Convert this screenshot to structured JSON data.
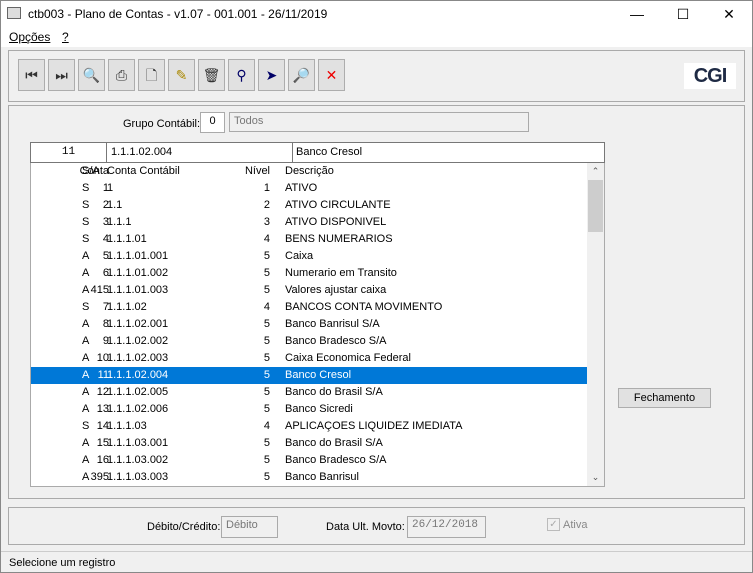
{
  "window": {
    "title": "ctb003 - Plano de Contas - v1.07 - 001.001 - 26/11/2019",
    "minimize": "—",
    "maximize": "☐",
    "close": "✕"
  },
  "menu": [
    "Opções",
    "?"
  ],
  "toolbar": [
    {
      "name": "first-record",
      "glyph": "⏮",
      "color": "#333"
    },
    {
      "name": "last-record",
      "glyph": "⏭",
      "color": "#333"
    },
    {
      "name": "search",
      "glyph": "🔍",
      "color": "#036"
    },
    {
      "name": "print",
      "glyph": "⎙",
      "color": "#333"
    },
    {
      "name": "new",
      "glyph": "🗋",
      "color": "#333"
    },
    {
      "name": "edit",
      "glyph": "✎",
      "color": "#a80"
    },
    {
      "name": "delete",
      "glyph": "🗑",
      "color": "#333"
    },
    {
      "name": "find",
      "glyph": "⚲",
      "color": "#006"
    },
    {
      "name": "filter",
      "glyph": "➤",
      "color": "#006"
    },
    {
      "name": "zoom",
      "glyph": "🔎",
      "color": "#36c"
    },
    {
      "name": "cancel",
      "glyph": "✕",
      "color": "#e00"
    }
  ],
  "logo": "CGI",
  "grupo": {
    "label": "Grupo Contábil:",
    "code": "0",
    "name": "Todos"
  },
  "selected": {
    "conta": "11",
    "conta_contabil": "1.1.1.02.004",
    "descricao": "Banco Cresol"
  },
  "columns": [
    "Conta",
    "S/A",
    "Conta Contábil",
    "Nível",
    "Descrição"
  ],
  "rows": [
    [
      "1",
      "S",
      "1",
      "1",
      "ATIVO"
    ],
    [
      "2",
      "S",
      "1.1",
      "2",
      "ATIVO CIRCULANTE"
    ],
    [
      "3",
      "S",
      "1.1.1",
      "3",
      "ATIVO DISPONIVEL"
    ],
    [
      "4",
      "S",
      "1.1.1.01",
      "4",
      "BENS NUMERARIOS"
    ],
    [
      "5",
      "A",
      "1.1.1.01.001",
      "5",
      "Caixa"
    ],
    [
      "6",
      "A",
      "1.1.1.01.002",
      "5",
      "Numerario em Transito"
    ],
    [
      "415",
      "A",
      "1.1.1.01.003",
      "5",
      "Valores ajustar caixa"
    ],
    [
      "7",
      "S",
      "1.1.1.02",
      "4",
      "BANCOS CONTA MOVIMENTO"
    ],
    [
      "8",
      "A",
      "1.1.1.02.001",
      "5",
      "Banco Banrisul S/A"
    ],
    [
      "9",
      "A",
      "1.1.1.02.002",
      "5",
      "Banco Bradesco S/A"
    ],
    [
      "10",
      "A",
      "1.1.1.02.003",
      "5",
      "Caixa Economica Federal"
    ],
    [
      "11",
      "A",
      "1.1.1.02.004",
      "5",
      "Banco Cresol"
    ],
    [
      "12",
      "A",
      "1.1.1.02.005",
      "5",
      "Banco do Brasil S/A"
    ],
    [
      "13",
      "A",
      "1.1.1.02.006",
      "5",
      "Banco Sicredi"
    ],
    [
      "14",
      "S",
      "1.1.1.03",
      "4",
      "APLICAÇOES LIQUIDEZ IMEDIATA"
    ],
    [
      "15",
      "A",
      "1.1.1.03.001",
      "5",
      "Banco do Brasil S/A"
    ],
    [
      "16",
      "A",
      "1.1.1.03.002",
      "5",
      "Banco Bradesco S/A"
    ],
    [
      "395",
      "A",
      "1.1.1.03.003",
      "5",
      "Banco Banrisul"
    ]
  ],
  "selected_index": 11,
  "fechamento": "Fechamento",
  "debito_credito": {
    "label": "Débito/Crédito:",
    "value": "Débito"
  },
  "data_ult": {
    "label": "Data Ult. Movto:",
    "value": "26/12/2018"
  },
  "ativa": {
    "label": "Ativa",
    "checked": true
  },
  "status": "Selecione um registro"
}
